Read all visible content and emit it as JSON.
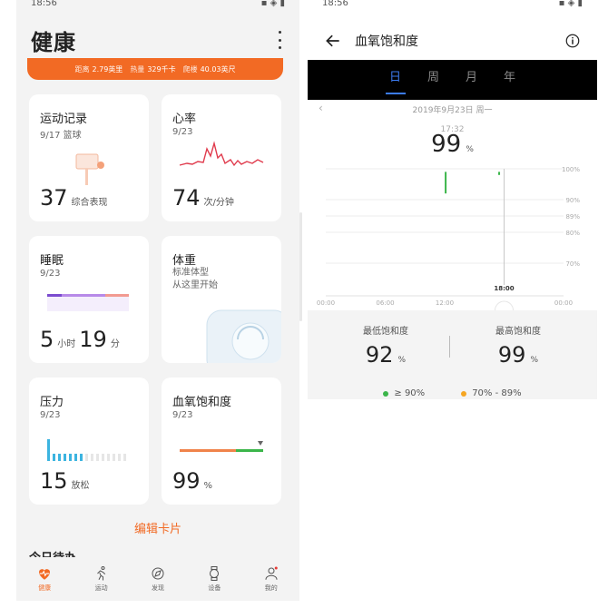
{
  "left": {
    "status_time": "18:56",
    "title": "健康",
    "summary": {
      "distance_label": "距离",
      "distance_value": "2.79英里",
      "calories_label": "热量",
      "calories_value": "329千卡",
      "climb_label": "爬楼",
      "climb_value": "40.03英尺"
    },
    "cards": {
      "workout": {
        "title": "运动记录",
        "date": "9/17 篮球",
        "value": "37",
        "unit": "综合表现"
      },
      "heart": {
        "title": "心率",
        "date": "9/23",
        "value": "74",
        "unit": "次/分钟"
      },
      "sleep": {
        "title": "睡眠",
        "date": "9/23",
        "hours": "5",
        "hours_unit": "小时",
        "minutes": "19",
        "minutes_unit": "分"
      },
      "weight": {
        "title": "体重",
        "line1": "标准体型",
        "line2": "从这里开始"
      },
      "stress": {
        "title": "压力",
        "date": "9/23",
        "value": "15",
        "unit": "放松"
      },
      "spo2": {
        "title": "血氧饱和度",
        "date": "9/23",
        "value": "99",
        "unit": "%"
      }
    },
    "edit_cards": "编辑卡片",
    "today_label": "今日待办",
    "nav": [
      {
        "label": "健康",
        "icon": "heart-pulse-icon"
      },
      {
        "label": "运动",
        "icon": "running-icon"
      },
      {
        "label": "发现",
        "icon": "discover-icon"
      },
      {
        "label": "设备",
        "icon": "watch-icon"
      },
      {
        "label": "我的",
        "icon": "profile-icon"
      }
    ],
    "colors": {
      "accent": "#f26a24"
    }
  },
  "right": {
    "status_time": "18:56",
    "title": "血氧饱和度",
    "tabs": [
      "日",
      "周",
      "月",
      "年"
    ],
    "active_tab": 0,
    "date": "2019年9月23日 周一",
    "selected_time": "17:32",
    "selected_value": "99",
    "selected_unit": "%",
    "low_label": "最低饱和度",
    "low_value": "92",
    "high_label": "最高饱和度",
    "high_value": "99",
    "percent_unit": "%",
    "legend": [
      {
        "label": "≥ 90%",
        "color": "#3bb54a"
      },
      {
        "label": "70% - 89%",
        "color": "#f5a623"
      }
    ],
    "cursor_label": "18:00"
  },
  "chart_data": {
    "type": "bar",
    "title": "",
    "x": [
      "00:00",
      "06:00",
      "12:00",
      "18:00",
      "00:00"
    ],
    "y_ticks": [
      "100%",
      "90%",
      "89%",
      "80%",
      "70%"
    ],
    "ylim": [
      70,
      100
    ],
    "series": [
      {
        "points": [
          {
            "hour": 12.1,
            "low": 92,
            "high": 99
          },
          {
            "hour": 17.5,
            "low": 98,
            "high": 99
          }
        ]
      }
    ]
  }
}
